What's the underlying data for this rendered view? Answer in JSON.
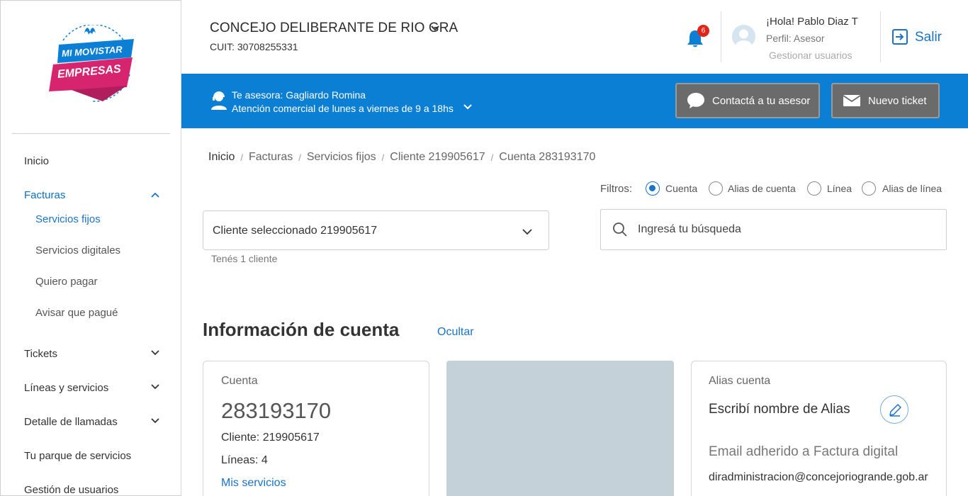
{
  "logo": {
    "line1": "MI MOVISTAR",
    "line2": "EMPRESAS",
    "brand_mark": "M"
  },
  "sidebar": {
    "items": [
      {
        "label": "Inicio"
      },
      {
        "label": "Facturas",
        "expanded": true,
        "active": true
      },
      {
        "label": "Tickets",
        "expanded": false
      },
      {
        "label": "Líneas y servicios",
        "expanded": false
      },
      {
        "label": "Detalle de llamadas",
        "expanded": false
      },
      {
        "label": "Tu parque de servicios"
      },
      {
        "label": "Gestión de usuarios"
      }
    ],
    "facturas_sub": [
      {
        "label": "Servicios fijos",
        "active": true
      },
      {
        "label": "Servicios digitales"
      },
      {
        "label": "Quiero pagar"
      },
      {
        "label": "Avisar que pagué"
      }
    ]
  },
  "header": {
    "company": "CONCEJO DELIBERANTE DE RIO GRA",
    "cuit": "CUIT: 30708255331",
    "notifications_count": "6",
    "greeting": "¡Hola! Pablo Diaz T",
    "profile": "Perfil: Asesor",
    "manage_users": "Gestionar usuarios",
    "logout": "Salir"
  },
  "band": {
    "advisor": "Te asesora: Gagliardo Romina",
    "hours": "Atención comercial de lunes a viernes de 9 a 18hs",
    "contact_button": "Contactá a tu asesor",
    "ticket_button": "Nuevo ticket"
  },
  "breadcrumb": [
    "Inicio",
    "Facturas",
    "Servicios fijos",
    "Cliente 219905617",
    "Cuenta 283193170"
  ],
  "filters": {
    "label": "Filtros:",
    "options": [
      "Cuenta",
      "Alias de cuenta",
      "Línea",
      "Alias de línea"
    ],
    "selected": "Cuenta"
  },
  "client_select": {
    "value": "Cliente seleccionado 219905617",
    "count_text": "Tenés 1 cliente"
  },
  "search": {
    "placeholder": "Ingresá tu búsqueda"
  },
  "account_section": {
    "title": "Información de cuenta",
    "hide_link": "Ocultar",
    "account_label": "Cuenta",
    "account_number": "283193170",
    "client": "Cliente: 219905617",
    "lines": "Líneas: 4",
    "services_link": "Mis servicios",
    "alias_label": "Alias cuenta",
    "alias_placeholder": "Escribí nombre de Alias",
    "email_label": "Email adherido a Factura digital",
    "email_value": "diradministracion@concejoriogrande.gob.ar"
  },
  "colors": {
    "brand_blue": "#0b7fd4",
    "link_blue": "#1a73c7",
    "logo_pink": "#d6246e",
    "badge_red": "#e1251b",
    "band_button_gray": "#6b6b6b"
  }
}
